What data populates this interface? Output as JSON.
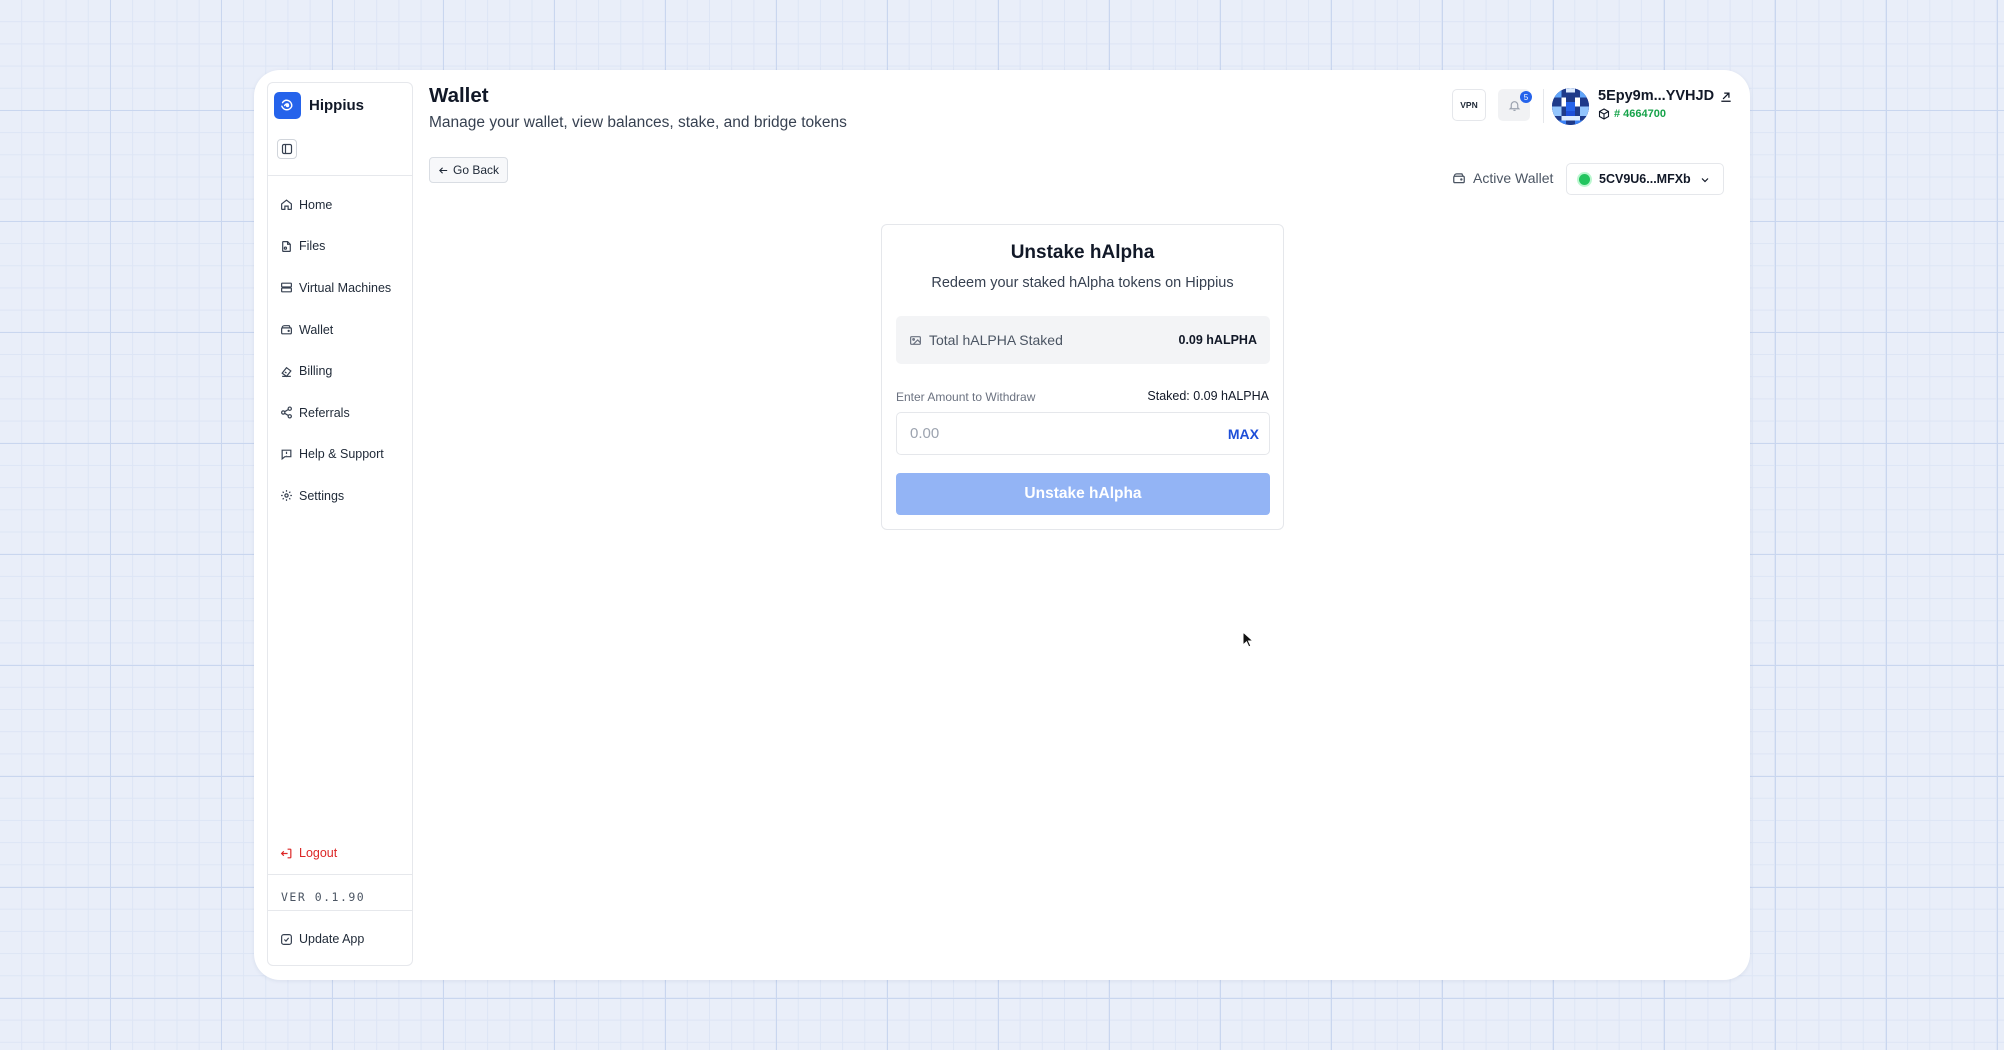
{
  "app": {
    "name": "Hippius"
  },
  "sidebar": {
    "items": [
      {
        "label": "Home",
        "icon": "home-icon"
      },
      {
        "label": "Files",
        "icon": "file-icon"
      },
      {
        "label": "Virtual Machines",
        "icon": "server-icon"
      },
      {
        "label": "Wallet",
        "icon": "wallet-icon"
      },
      {
        "label": "Billing",
        "icon": "billing-icon"
      },
      {
        "label": "Referrals",
        "icon": "share-icon"
      },
      {
        "label": "Help & Support",
        "icon": "help-icon"
      },
      {
        "label": "Settings",
        "icon": "gear-icon"
      }
    ],
    "logout_label": "Logout",
    "version": "VER 0.1.90",
    "update_label": "Update App"
  },
  "header": {
    "title": "Wallet",
    "subtitle": "Manage your wallet, view balances, stake, and bridge tokens",
    "back_label": "Go Back",
    "vpn_label": "VPN",
    "notification_count": "5",
    "account_address": "5Epy9m...YVHJD",
    "block_number": "# 4664700",
    "active_wallet_label": "Active Wallet",
    "active_wallet_address": "5CV9U6...MFXb"
  },
  "unstake_card": {
    "title": "Unstake hAlpha",
    "subtitle": "Redeem your staked hAlpha tokens on Hippius",
    "total_label": "Total hALPHA Staked",
    "total_value": "0.09 hALPHA",
    "amount_label": "Enter Amount to Withdraw",
    "staked_label": "Staked: 0.09 hALPHA",
    "amount_placeholder": "0.00",
    "amount_value": "",
    "max_label": "MAX",
    "submit_label": "Unstake hAlpha"
  },
  "colors": {
    "accent": "#2563eb",
    "button_disabled": "#93b4f5",
    "logout": "#dc2626",
    "status_online": "#22c55e",
    "block_number": "#16a34a"
  }
}
